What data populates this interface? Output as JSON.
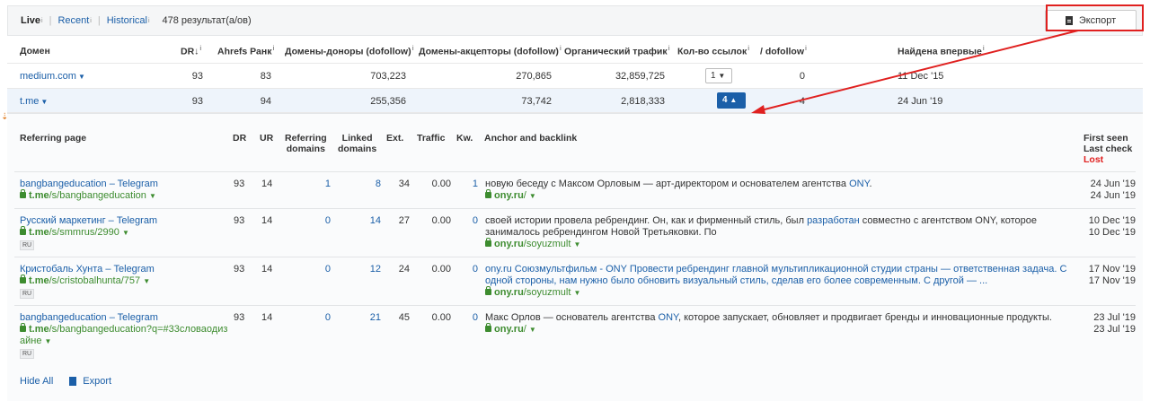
{
  "tabs": {
    "live": "Live",
    "recent": "Recent",
    "historical": "Historical",
    "info_mark": "i",
    "results_count": "478 результат(а/ов)"
  },
  "export_button": {
    "label": "Экспорт"
  },
  "main_table": {
    "headers": {
      "domain": "Домен",
      "dr": "DR",
      "dr_sort": "↓",
      "ahrefs_rank": "Ahrefs Ранк",
      "ref_domains": "Домены-доноры (dofollow)",
      "linked_domains": "Домены-акцепторы (dofollow)",
      "organic_traffic": "Органический трафик",
      "link_count": "Кол-во ссылок",
      "dofollow": "/ dofollow",
      "first_seen": "Найдена впервые"
    },
    "rows": [
      {
        "domain": "medium.com",
        "dr": "93",
        "ahrefs_rank": "83",
        "ref_domains": "703,223",
        "linked_domains": "270,865",
        "organic_traffic": "32,859,725",
        "link_count": "1",
        "dofollow": "0",
        "first_seen": "11 Dec '15"
      },
      {
        "domain": "t.me",
        "dr": "93",
        "ahrefs_rank": "94",
        "ref_domains": "255,356",
        "linked_domains": "73,742",
        "organic_traffic": "2,818,333",
        "link_count": "4",
        "dofollow": "4",
        "first_seen": "24 Jun '19"
      }
    ]
  },
  "panel": {
    "headers": {
      "referring_page": "Referring page",
      "dr": "DR",
      "ur": "UR",
      "referring": "Referring",
      "domains": "domains",
      "linked": "Linked",
      "ext": "Ext.",
      "traffic": "Traffic",
      "kw": "Kw.",
      "anchor": "Anchor and backlink",
      "first_seen": "First seen",
      "last_check": "Last check",
      "lost": "Lost"
    },
    "rows": [
      {
        "title": "bangbangeducation – Telegram",
        "url_host": "t.me",
        "url_path": "/s/bangbangeducation",
        "lang": "",
        "dr": "93",
        "ur": "14",
        "ref_domains": "1",
        "linked_domains": "8",
        "ext": "34",
        "traffic": "0.00",
        "kw": "1",
        "anchor_before": "новую беседу с Максом Орловым — арт-директором и основателем агентства ",
        "anchor_kw": "ONY",
        "anchor_after": ".",
        "target_host": "ony.ru",
        "target_path": "/",
        "first_seen": "24 Jun '19",
        "last_check": "24 Jun '19"
      },
      {
        "title": "Русский маркетинг – Telegram",
        "url_host": "t.me",
        "url_path": "/s/smmrus/2990",
        "lang": "RU",
        "dr": "93",
        "ur": "14",
        "ref_domains": "0",
        "linked_domains": "14",
        "ext": "27",
        "traffic": "0.00",
        "kw": "0",
        "anchor_before": "своей истории провела ребрендинг. Он, как и фирменный стиль, был ",
        "anchor_kw": "разработан",
        "anchor_after": " совместно с агентством ONY, которое занималось ребрендингом Новой Третьяковки. По",
        "target_host": "ony.ru",
        "target_path": "/soyuzmult",
        "first_seen": "10 Dec '19",
        "last_check": "10 Dec '19"
      },
      {
        "title": "Кристобаль Хунта – Telegram",
        "url_host": "t.me",
        "url_path": "/s/cristobalhunta/757",
        "lang": "RU",
        "dr": "93",
        "ur": "14",
        "ref_domains": "0",
        "linked_domains": "12",
        "ext": "24",
        "traffic": "0.00",
        "kw": "0",
        "anchor_before": "",
        "anchor_kw": "ony.ru Союзмультфильм - ONY Провести ребрендинг главной мультипликационной студии страны — ответственная задача. С одной стороны, нам нужно было обновить визуальный стиль, сделав его более современным. С другой — ...",
        "anchor_after": "",
        "target_host": "ony.ru",
        "target_path": "/soyuzmult",
        "first_seen": "17 Nov '19",
        "last_check": "17 Nov '19"
      },
      {
        "title": "bangbangeducation – Telegram",
        "url_host": "t.me",
        "url_path": "/s/bangbangeducation?q=#33словаодиз",
        "url_path2": "айне",
        "lang": "RU",
        "dr": "93",
        "ur": "14",
        "ref_domains": "0",
        "linked_domains": "21",
        "ext": "45",
        "traffic": "0.00",
        "kw": "0",
        "anchor_before": "Макс Орлов — основатель агентства ",
        "anchor_kw": "ONY",
        "anchor_after": ", которое запускает, обновляет и продвигает бренды и инновационные продукты.",
        "target_host": "ony.ru",
        "target_path": "/",
        "first_seen": "23 Jul '19",
        "last_check": "23 Jul '19"
      }
    ],
    "footer": {
      "hide_all": "Hide All",
      "export": "Export"
    }
  },
  "colors": {
    "link": "#1b5fa8",
    "url_green": "#3d8c2f",
    "annotation_red": "#e0201f",
    "active_select": "#1b5fa8"
  },
  "icons": {
    "export": "document-icon",
    "lock": "lock-icon",
    "caret": "caret-down-icon",
    "arrow": "arrow-annotation"
  }
}
